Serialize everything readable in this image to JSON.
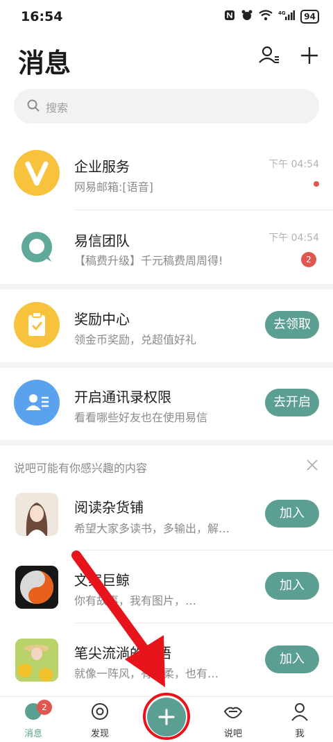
{
  "status_bar": {
    "time": "16:54",
    "battery": "94",
    "network": "4G"
  },
  "header": {
    "title": "消息"
  },
  "search": {
    "placeholder": "搜索"
  },
  "conversations": [
    {
      "title": "企业服务",
      "subtitle": "网易邮箱:[语音]",
      "time": "下午 04:54",
      "has_dot": true,
      "avatar_letter": "V"
    },
    {
      "title": "易信团队",
      "subtitle": "【稿费升级】千元稿费周周得!",
      "time": "下午 04:54",
      "badge": "2"
    }
  ],
  "promos": [
    {
      "title": "奖励中心",
      "subtitle": "领金币奖励，兑超值好礼",
      "action": "去领取"
    },
    {
      "title": "开启通讯录权限",
      "subtitle": "看看哪些好友也在使用易信",
      "action": "去开启"
    }
  ],
  "recommend": {
    "heading": "说吧可能有你感兴趣的内容",
    "items": [
      {
        "title": "阅读杂货铺",
        "subtitle": "希望大家多读书，多输出，解…",
        "action": "加入"
      },
      {
        "title": "文案巨鲸",
        "subtitle": "你有故事，我有图片，…",
        "action": "加入"
      },
      {
        "title": "笔尖流淌的心语",
        "subtitle": "就像一阵风，有温柔，也有…",
        "action": "加入"
      }
    ]
  },
  "tabs": [
    {
      "label": "消息",
      "badge": "2"
    },
    {
      "label": "发现"
    },
    {
      "label": "说吧"
    },
    {
      "label": "我"
    }
  ],
  "colors": {
    "accent": "#5b9e92",
    "badge": "#e05750",
    "yellow": "#f7c33c",
    "blue": "#5ba2ee",
    "annotation_red": "#e8141c"
  }
}
